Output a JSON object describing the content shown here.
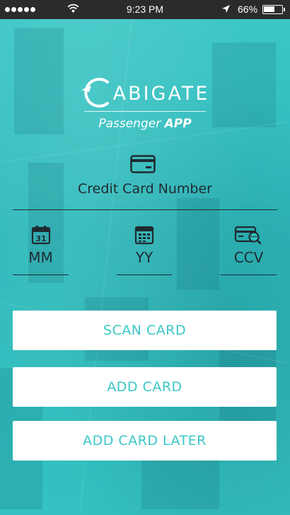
{
  "status_bar": {
    "time": "9:23 PM",
    "battery_percent": "66%",
    "battery_level": 0.66,
    "signal_dots": 5,
    "icons": [
      "signal-dots-icon",
      "wifi-icon",
      "location-arrow-icon",
      "battery-icon"
    ]
  },
  "brand": {
    "logo_text": "ABIGATE",
    "tagline_regular": "Passenger ",
    "tagline_bold": "APP"
  },
  "card_number": {
    "icon": "credit-card-icon",
    "label": "Credit Card Number"
  },
  "fields": {
    "month": {
      "icon": "calendar-icon",
      "label": "MM"
    },
    "year": {
      "icon": "calendar-grid-icon",
      "label": "YY"
    },
    "ccv": {
      "icon": "card-search-icon",
      "label": "CCV"
    }
  },
  "buttons": {
    "scan": "SCAN CARD",
    "add": "ADD CARD",
    "add_later": "ADD CARD LATER"
  },
  "colors": {
    "accent": "#3bc7c6",
    "dark_text": "#1f2a30",
    "status_bar": "#2b2b2b"
  }
}
